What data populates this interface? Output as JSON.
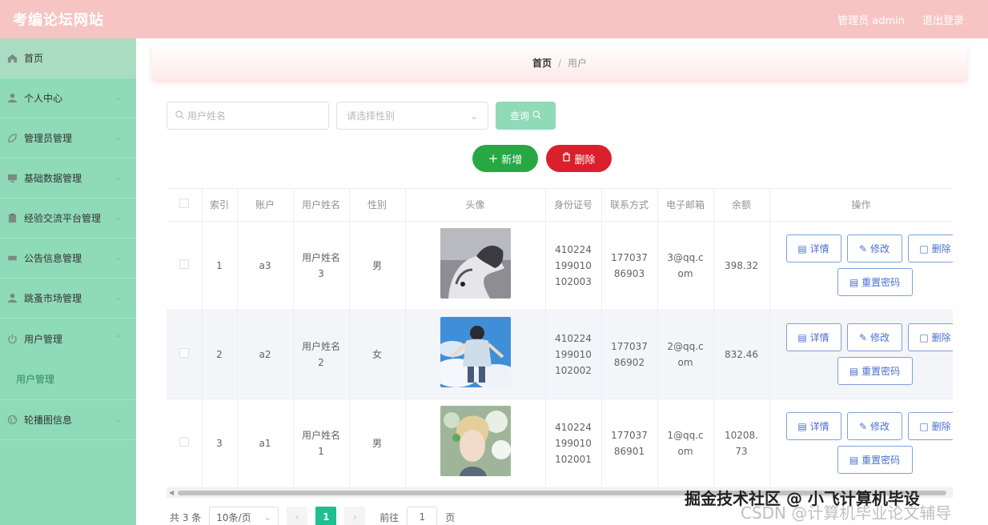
{
  "header": {
    "title": "考编论坛网站",
    "admin_label": "管理员 admin",
    "logout": "退出登录"
  },
  "sidebar": {
    "items": [
      {
        "label": "首页",
        "icon": "home-icon"
      },
      {
        "label": "个人中心",
        "icon": "user-icon"
      },
      {
        "label": "管理员管理",
        "icon": "leaf-icon"
      },
      {
        "label": "基础数据管理",
        "icon": "monitor-icon"
      },
      {
        "label": "经验交流平台管理",
        "icon": "clipboard-icon"
      },
      {
        "label": "公告信息管理",
        "icon": "ticket-icon"
      },
      {
        "label": "跳蚤市场管理",
        "icon": "user-icon"
      },
      {
        "label": "用户管理",
        "icon": "power-icon"
      },
      {
        "label": "用户管理",
        "icon": ""
      },
      {
        "label": "轮播图信息",
        "icon": "globe-icon"
      }
    ]
  },
  "breadcrumb": {
    "home": "首页",
    "sep": "/",
    "current": "用户"
  },
  "filters": {
    "name_placeholder": "用户姓名",
    "sex_placeholder": "请选择性别",
    "query_label": "查询"
  },
  "actions": {
    "add_label": "新增",
    "delete_label": "删除"
  },
  "table": {
    "headers": [
      "索引",
      "账户",
      "用户姓名",
      "性别",
      "头像",
      "身份证号",
      "联系方式",
      "电子邮箱",
      "余额",
      "操作"
    ],
    "rows": [
      {
        "index": "1",
        "account": "a3",
        "name": "用户姓名3",
        "sex": "男",
        "idcard": "410224199010102003",
        "phone": "17703786903",
        "email": "3@qq.com",
        "balance": "398.32",
        "avatar": "husky"
      },
      {
        "index": "2",
        "account": "a2",
        "name": "用户姓名2",
        "sex": "女",
        "idcard": "410224199010102002",
        "phone": "17703786902",
        "email": "2@qq.com",
        "balance": "832.46",
        "avatar": "sky-boy"
      },
      {
        "index": "3",
        "account": "a1",
        "name": "用户姓名1",
        "sex": "男",
        "idcard": "410224199010102001",
        "phone": "17703786901",
        "email": "1@qq.com",
        "balance": "10208.73",
        "avatar": "blonde-boy"
      }
    ],
    "row_buttons": {
      "detail": "详情",
      "edit": "修改",
      "delete": "删除",
      "reset": "重置密码"
    }
  },
  "pagination": {
    "total": "共 3 条",
    "page_size": "10条/页",
    "current_page": "1",
    "goto_prefix": "前往",
    "goto_value": "1",
    "goto_suffix": "页"
  },
  "watermark": {
    "line1": "掘金技术社区 @ 小飞计算机毕设",
    "line2": "CSDN @计算机毕业论文辅导"
  },
  "colors": {
    "header": "#f7c4c4",
    "sidebar": "#8fdab7",
    "add": "#27a843",
    "delete": "#d9202c",
    "accent": "#1fbf8f"
  }
}
